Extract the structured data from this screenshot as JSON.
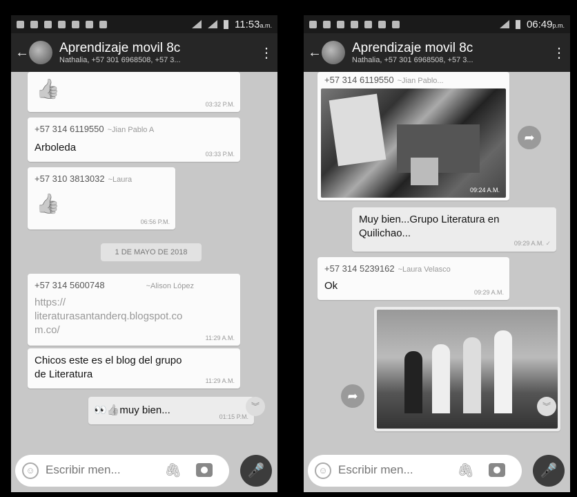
{
  "left": {
    "status_time": "11:53",
    "status_ampm": "a.m.",
    "title": "Aprendizaje movil 8c",
    "members": "Nathalia, +57 301 6968508, +57 3...",
    "messages": [
      {
        "time": "03:32 P.M."
      },
      {
        "sender": "+57 314 6119550",
        "alias": "~Jian Pablo A",
        "text": "Arboleda",
        "time": "03:33 P.M."
      },
      {
        "sender": "+57 310 3813032",
        "alias": "~Laura",
        "time": "06:56 P.M."
      },
      {
        "sender": "+57 314 5600748",
        "alias": "~Alison López",
        "text1": "https://",
        "text2": "literaturasantanderq.blogspot.co",
        "text3": "m.co/",
        "time": "11:29 A.M."
      },
      {
        "text1": "Chicos este es el blog del grupo",
        "text2": "de Literatura",
        "time": "11:29 A.M."
      },
      {
        "text": "muy bien...",
        "time": "01:15 P.M."
      }
    ],
    "date_separator": "1 DE MAYO DE 2018",
    "input_placeholder": "Escribir men..."
  },
  "right": {
    "status_time": "06:49",
    "status_ampm": "p.m.",
    "title": "Aprendizaje movil 8c",
    "members": "Nathalia, +57 301 6968508, +57 3...",
    "messages": [
      {
        "sender": "+57 314 6119550",
        "alias": "~Jian Pablo...",
        "time": "09:24 A.M."
      },
      {
        "text1": "Muy bien...Grupo Literatura en",
        "text2": "Quilichao...",
        "time": "09:29 A.M."
      },
      {
        "sender": "+57 314 5239162",
        "alias": "~Laura Velasco",
        "text": "Ok",
        "time": "09:29 A.M."
      }
    ],
    "input_placeholder": "Escribir men..."
  },
  "icons": {
    "back": "arrow-left-icon",
    "menu": "more-vert-icon",
    "emoji": "emoji-icon",
    "attach": "paperclip-icon",
    "camera": "camera-icon",
    "mic": "mic-icon",
    "forward": "forward-icon"
  }
}
